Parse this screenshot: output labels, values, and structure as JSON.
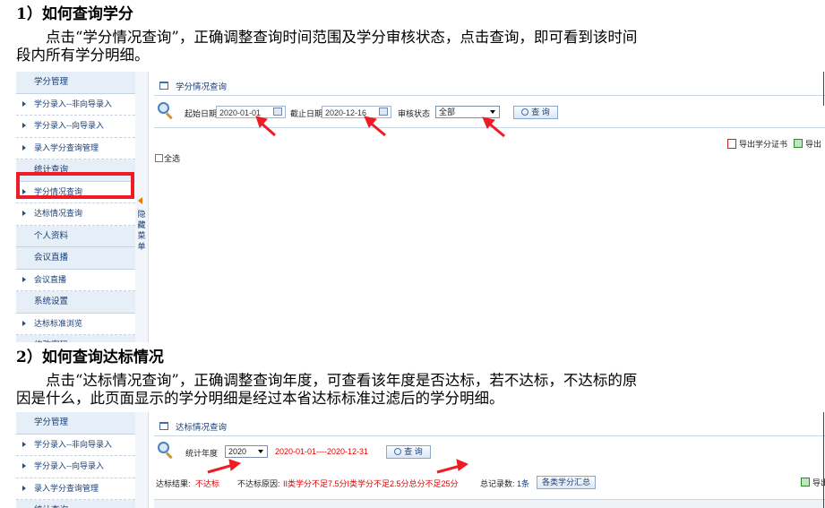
{
  "section1": {
    "heading": "1）如何查询学分",
    "para_line1": "点击“学分情况查询”，正确调整查询时间范围及学分审核状态，点击查询，即可看到该时间",
    "para_line2": "段内所有学分明细。"
  },
  "section2": {
    "heading": "2）如何查询达标情况",
    "para_line1": "点击“达标情况查询”，正确调整查询年度，可查看该年度是否达标，若不达标，不达标的原",
    "para_line2": "因是什么，此页面显示的学分明细是经过本省达标标准过滤后的学分明细。"
  },
  "sidebar": {
    "items": [
      {
        "label": "学分管理",
        "type": "category"
      },
      {
        "label": "学分录入--非向导录入",
        "type": "item"
      },
      {
        "label": "学分录入--向导录入",
        "type": "item"
      },
      {
        "label": "录入学分查询管理",
        "type": "item"
      },
      {
        "label": "统计查询",
        "type": "category"
      },
      {
        "label": "学分情况查询",
        "type": "item"
      },
      {
        "label": "达标情况查询",
        "type": "item"
      },
      {
        "label": "个人资料",
        "type": "category"
      },
      {
        "label": "会议直播",
        "type": "category"
      },
      {
        "label": "会议直播",
        "type": "item"
      },
      {
        "label": "系统设置",
        "type": "category"
      },
      {
        "label": "达标标准浏览",
        "type": "item"
      },
      {
        "label": "修改密码",
        "type": "category"
      }
    ],
    "items2": [
      {
        "label": "学分管理",
        "type": "category"
      },
      {
        "label": "学分录入--非向导录入",
        "type": "item"
      },
      {
        "label": "学分录入--向导录入",
        "type": "item"
      },
      {
        "label": "录入学分查询管理",
        "type": "item"
      },
      {
        "label": "统计查询",
        "type": "category"
      }
    ],
    "hide_menu_label": "隐藏菜单"
  },
  "shot1": {
    "tab_title": "学分情况查询",
    "start_date_label": "起始日期",
    "start_date_value": "2020-01-01",
    "end_date_label": "截止日期",
    "end_date_value": "2020-12-16",
    "status_label": "审核状态",
    "status_value": "全部",
    "query_button": "查 询",
    "export_cert": "导出学分证书",
    "export_other": "导出",
    "select_all": "全选"
  },
  "shot2": {
    "tab_title": "达标情况查询",
    "year_label": "统计年度",
    "year_value": "2020",
    "date_range": "2020-01-01----2020-12-31",
    "query_button": "查 询",
    "result_label": "达标结果:",
    "result_value": "不达标",
    "reason_label": "不达标原因:",
    "reason_value": "II类学分不足7.5分I类学分不足2.5分总分不足25分",
    "total_label": "总记录数:",
    "total_value": "1条",
    "summary_button": "各类学分汇总",
    "export_other": "导出"
  },
  "colors": {
    "highlight": "#ee1c25",
    "annotation_arrow": "#ee1c25",
    "sidebar_category_bg": "#e6eef8",
    "link_blue": "#1a3f75",
    "alert_red": "#e00000"
  }
}
